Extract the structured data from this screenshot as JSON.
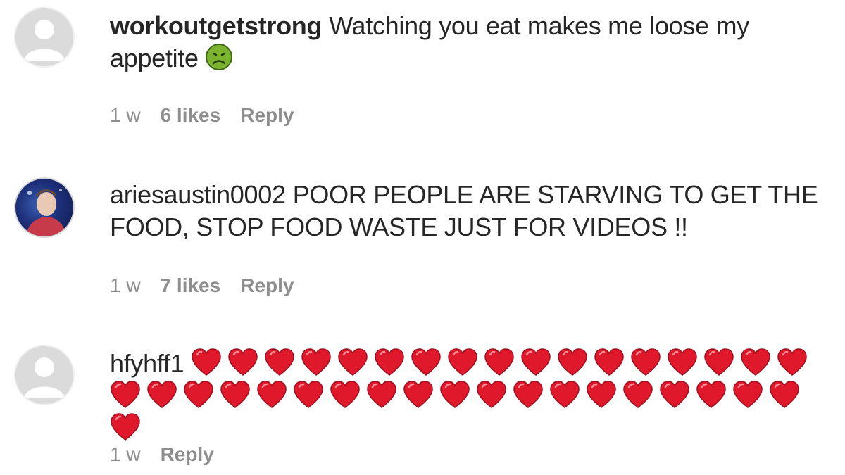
{
  "comments": [
    {
      "username": "workoutgetstrong",
      "text": "Watching you eat makes me loose my appetite",
      "emoji": "nauseated-face-icon",
      "time": "1 w",
      "likes": "6 likes",
      "reply": "Reply",
      "avatar": "default-avatar"
    },
    {
      "username": "ariesaustin0002",
      "text": "POOR PEOPLE ARE STARVING TO GET THE FOOD, STOP FOOD WASTE JUST FOR VIDEOS !!",
      "time": "1 w",
      "likes": "7 likes",
      "reply": "Reply",
      "avatar": "photo-avatar"
    },
    {
      "username": "hfyhff1",
      "text": "",
      "emoji": "red-heart-icon",
      "heart_count": 37,
      "time": "1 w",
      "reply": "Reply",
      "avatar": "default-avatar"
    }
  ],
  "colors": {
    "text": "#262626",
    "meta": "#8e8e8e",
    "heart": "#e0182c",
    "avatar_bg": "#dbdbdb"
  }
}
